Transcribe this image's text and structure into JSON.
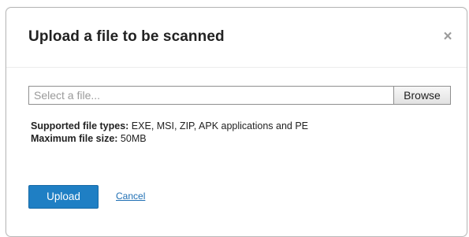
{
  "dialog": {
    "title": "Upload a file to be scanned",
    "close_glyph": "×",
    "close_icon": "close-icon"
  },
  "file_picker": {
    "placeholder": "Select a file...",
    "value": "",
    "browse_label": "Browse"
  },
  "info": {
    "types_label": "Supported file types:",
    "types_value": " EXE, MSI, ZIP, APK applications and PE",
    "size_label": "Maximum file size:",
    "size_value": " 50MB"
  },
  "actions": {
    "upload_label": "Upload",
    "cancel_label": "Cancel"
  },
  "colors": {
    "primary": "#1f7fc4",
    "link": "#1f6fb4",
    "close_icon": "#9b9b9b"
  }
}
